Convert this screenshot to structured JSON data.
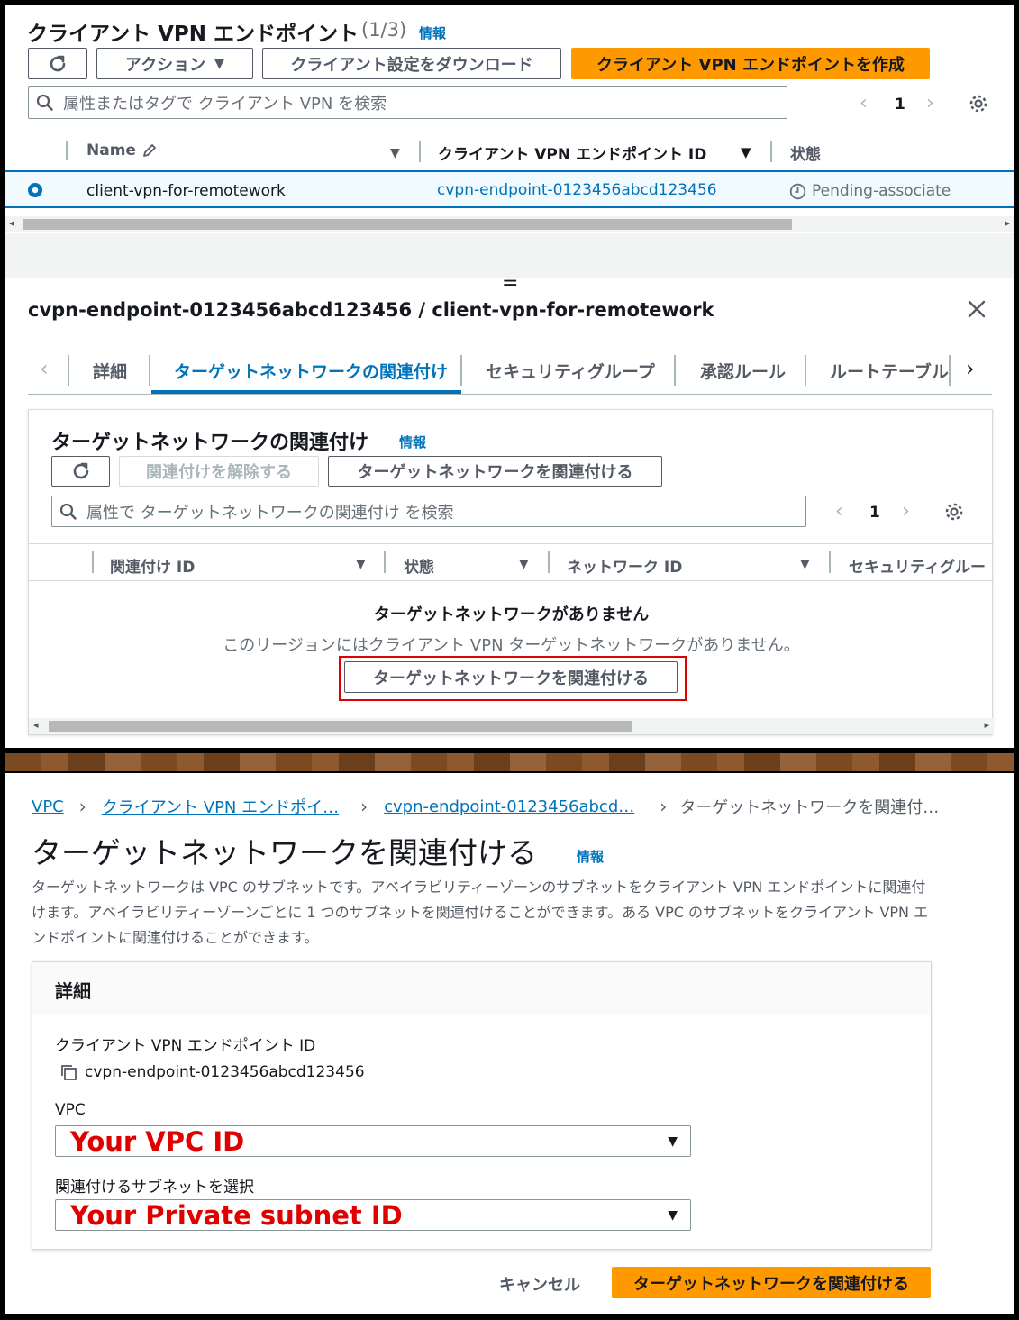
{
  "top": {
    "title": "クライアント VPN エンドポイント",
    "count": "(1/3)",
    "info": "情報",
    "actions_label": "アクション",
    "download_label": "クライアント設定をダウンロード",
    "create_label": "クライアント VPN エンドポイントを作成",
    "search_placeholder": "属性またはタグで クライアント VPN を検索",
    "page": "1",
    "columns": [
      "Name",
      "クライアント VPN エンドポイント ID",
      "状態"
    ],
    "row": {
      "name": "client-vpn-for-remotework",
      "endpoint_id": "cvpn-endpoint-0123456abcd123456",
      "status": "Pending-associate"
    }
  },
  "detail": {
    "resize_handle": "=",
    "title_id": "cvpn-endpoint-0123456abcd123456",
    "title_sep": "/",
    "title_name": "client-vpn-for-remotework",
    "tabs": [
      "詳細",
      "ターゲットネットワークの関連付け",
      "セキュリティグループ",
      "承認ルール",
      "ルートテーブル"
    ],
    "active_tab": 1,
    "section_title": "ターゲットネットワークの関連付け",
    "info": "情報",
    "disassociate_label": "関連付けを解除する",
    "associate_label": "ターゲットネットワークを関連付ける",
    "search_placeholder": "属性で ターゲットネットワークの関連付け を検索",
    "page": "1",
    "columns": [
      "関連付け ID",
      "状態",
      "ネットワーク ID",
      "セキュリティグルー"
    ],
    "empty_title": "ターゲットネットワークがありません",
    "empty_desc": "このリージョンにはクライアント VPN ターゲットネットワークがありません。",
    "empty_button": "ターゲットネットワークを関連付ける",
    "highlight_color": "#e00000"
  },
  "form": {
    "breadcrumb": [
      "VPC",
      "クライアント VPN エンドポイ…",
      "cvpn-endpoint-0123456abcd…",
      "ターゲットネットワークを関連付…"
    ],
    "title": "ターゲットネットワークを関連付ける",
    "info": "情報",
    "description": "ターゲットネットワークは VPC のサブネットです。アベイラビリティーゾーンのサブネットをクライアント VPN エンドポイントに関連付けます。アベイラビリティーゾーンごとに 1 つのサブネットを関連付けることができます。ある VPC のサブネットをクライアント VPN エンドポイントに関連付けることができます。",
    "card_title": "詳細",
    "endpoint_label": "クライアント VPN エンドポイント ID",
    "endpoint_value": "cvpn-endpoint-0123456abcd123456",
    "vpc_label": "VPC",
    "vpc_value": "Your VPC ID",
    "subnet_label": "関連付けるサブネットを選択",
    "subnet_value": "Your Private subnet ID",
    "cancel_label": "キャンセル",
    "submit_label": "ターゲットネットワークを関連付ける"
  },
  "colors": {
    "primary": "#ff9900",
    "link": "#0073bb",
    "selected_row_bg": "#f1faff",
    "annotation_red": "#e00000"
  }
}
